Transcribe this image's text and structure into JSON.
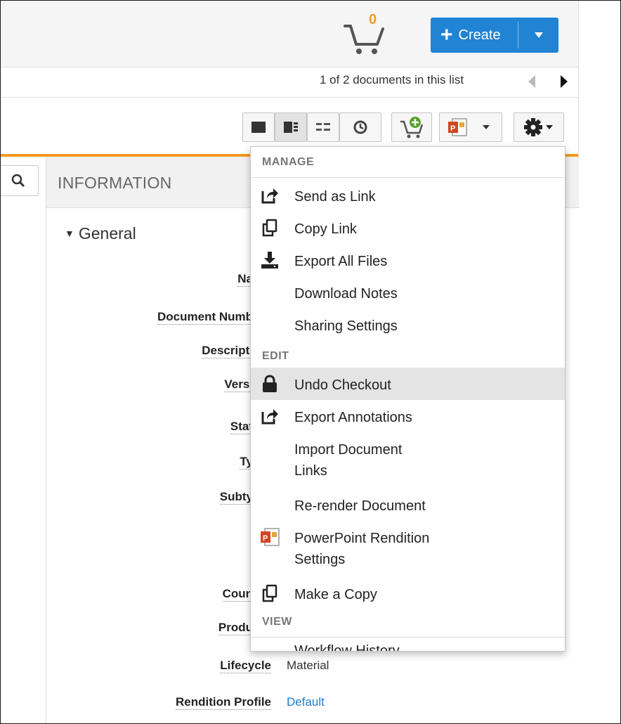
{
  "header": {
    "cart_count": "0",
    "create_label": "Create"
  },
  "docnav": {
    "position_text": "1 of 2 documents in this list"
  },
  "info": {
    "title": "INFORMATION",
    "section": "General",
    "fields": [
      {
        "label": "Name",
        "visible": "Na"
      },
      {
        "label": "Document Number",
        "visible": "Document Numb"
      },
      {
        "label": "Description",
        "visible": "Descripti"
      },
      {
        "label": "Version",
        "visible": "Versi"
      },
      {
        "label": "Status",
        "visible": "Stat"
      },
      {
        "label": "Type",
        "visible": "Ty"
      },
      {
        "label": "Subtype",
        "visible": "Subty"
      },
      {
        "label": "Country",
        "visible": "Coun"
      },
      {
        "label": "Product",
        "visible": "Produ"
      },
      {
        "label": "Lifecycle",
        "visible": "Lifecycle",
        "value": "Material"
      },
      {
        "label": "Rendition Profile",
        "visible": "Rendition Profile",
        "value": "Default"
      }
    ]
  },
  "menu": {
    "manage_header": "MANAGE",
    "edit_header": "EDIT",
    "view_header": "VIEW",
    "items": [
      {
        "label": "Send as Link",
        "icon": "share-icon"
      },
      {
        "label": "Copy Link",
        "icon": "copy-icon"
      },
      {
        "label": "Export All Files",
        "icon": "download-icon"
      },
      {
        "label": "Download Notes",
        "icon": ""
      },
      {
        "label": "Sharing Settings",
        "icon": ""
      },
      {
        "label": "Undo Checkout",
        "icon": "lock-icon"
      },
      {
        "label": "Export Annotations",
        "icon": "share-icon"
      },
      {
        "label": "Import Document Links",
        "line1": "Import Document",
        "line2": "Links",
        "icon": ""
      },
      {
        "label": "Re-render Document",
        "icon": ""
      },
      {
        "label": "PowerPoint Rendition Settings",
        "line1": "PowerPoint Rendition",
        "line2": "Settings",
        "icon": "powerpoint-icon"
      },
      {
        "label": "Make a Copy",
        "icon": "copy-icon"
      },
      {
        "label": "Workflow History",
        "icon": ""
      }
    ]
  },
  "colors": {
    "accent_blue": "#2083d4",
    "accent_orange": "#f39a1f",
    "link_blue": "#1f7ad0",
    "hover_gray": "#e4e4e4"
  }
}
